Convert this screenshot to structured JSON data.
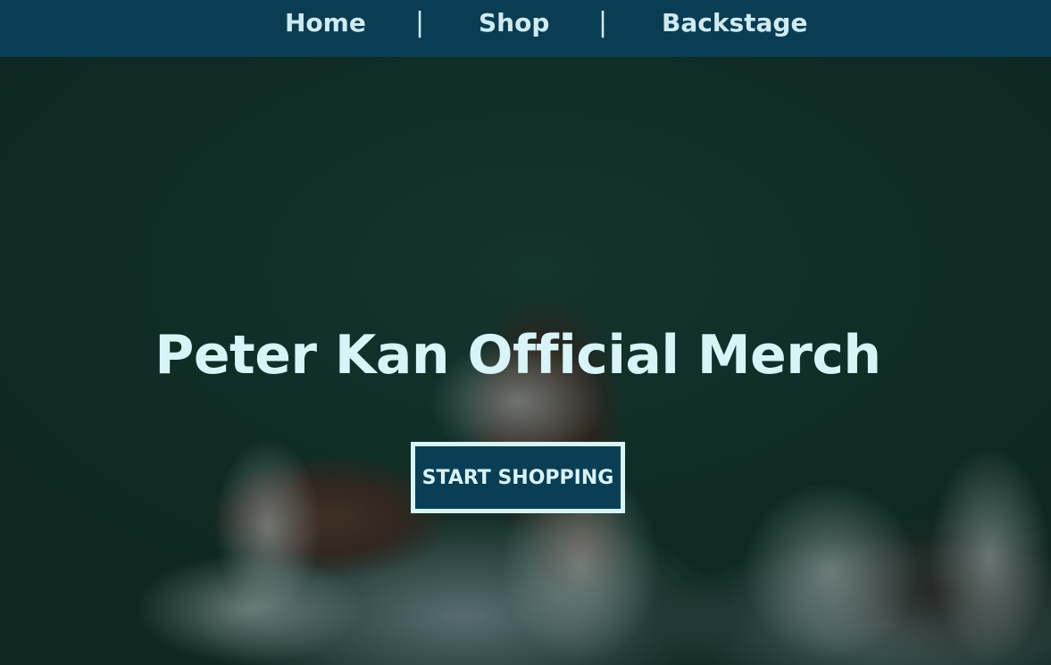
{
  "nav": {
    "items": [
      {
        "label": "Home"
      },
      {
        "label": "Shop"
      },
      {
        "label": "Backstage"
      }
    ],
    "separator": "|"
  },
  "hero": {
    "title": "Peter Kan Official Merch",
    "cta_label": "START SHOPPING"
  },
  "colors": {
    "nav_background": "#0a3e55",
    "text_light": "#d8f4f6",
    "button_background": "#0a3e55",
    "button_border": "#d8f4f6"
  }
}
